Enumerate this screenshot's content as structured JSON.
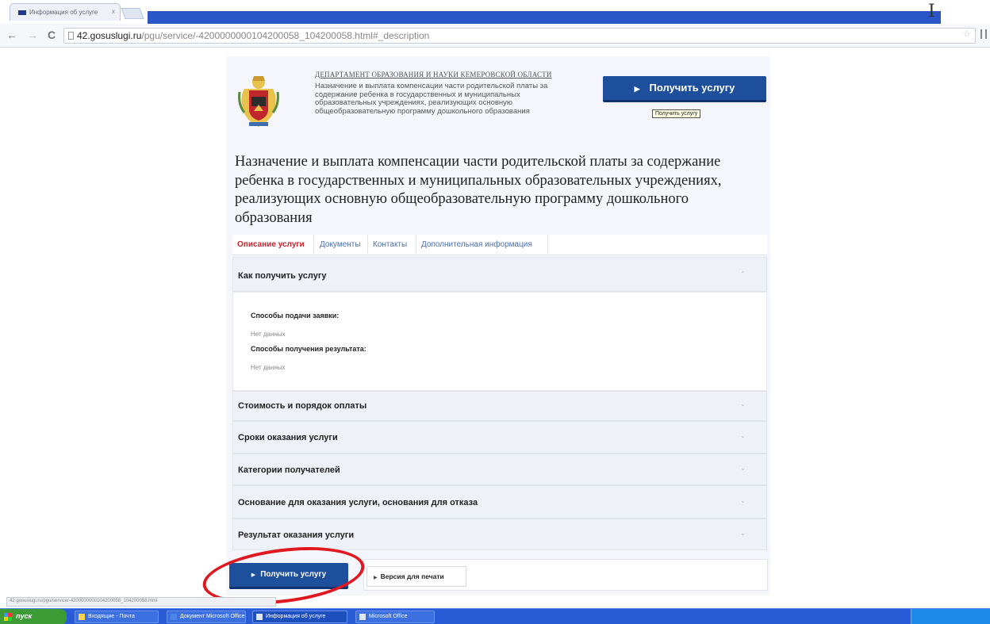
{
  "browser": {
    "tab_title": "Информация об услуге",
    "tab_close": "x",
    "address": {
      "host": "42.gosuslugi.ru",
      "path": "/pgu/service/-4200000000104200058_104200058.html#_description"
    },
    "back": "←",
    "forward": "→",
    "reload": "C",
    "star": "☆",
    "status_url": "42.gosuslugi.ru/pgu/service/-4200000000104200058_104200058.html"
  },
  "header": {
    "department": "ДЕПАРТАМЕНТ ОБРАЗОВАНИЯ И НАУКИ КЕМЕРОВСКОЙ ОБЛАСТИ",
    "short_description": "Назначение и выплата компенсации части родительской платы за содержание ребенка в государственных и муниципальных образовательных учреждениях, реализующих основную общеобразовательную программу дошкольного образования",
    "get_service_button": "Получить услугу",
    "tooltip": "Получить услугу"
  },
  "title": "Назначение и выплата компенсации части родительской платы за содержание ребенка в государственных и муниципальных образовательных учреждениях, реализующих основную общеобразовательную программу дошкольного образования",
  "tabs": [
    {
      "label": "Описание услуги",
      "active": true
    },
    {
      "label": "Документы",
      "active": false
    },
    {
      "label": "Контакты",
      "active": false
    },
    {
      "label": "Дополнительная информация",
      "active": false
    }
  ],
  "accordion": {
    "expanded": {
      "label": "Как получить услугу",
      "submit_methods_heading": "Способы подачи заявки:",
      "submit_methods_value": "Нет данных",
      "result_methods_heading": "Способы получения результата:",
      "result_methods_value": "Нет данных"
    },
    "collapsed": [
      {
        "label": "Стоимость и порядок оплаты"
      },
      {
        "label": "Сроки оказания услуги"
      },
      {
        "label": "Категории получателей"
      },
      {
        "label": "Основание для оказания услуги, основания для отказа"
      },
      {
        "label": "Результат оказания услуги"
      }
    ],
    "chevron": "⌄"
  },
  "footer": {
    "get_service_button": "Получить услугу",
    "print_button": "Версия для печати"
  },
  "taskbar": {
    "start": "пуск",
    "items": [
      {
        "label": "Входящие - Почта"
      },
      {
        "label": "Документ Microsoft Office"
      },
      {
        "label": "Информация об услуге"
      },
      {
        "label": "Microsoft Office"
      }
    ]
  },
  "colors": {
    "accent": "#1e4f9c",
    "active_tab": "#c8202a",
    "highlight": "#e01820"
  }
}
